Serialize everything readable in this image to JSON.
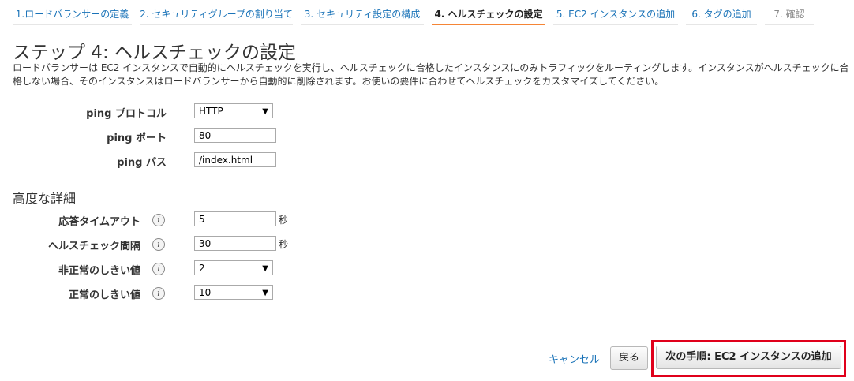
{
  "tabs": [
    {
      "label": "1.ロードバランサーの定義"
    },
    {
      "label": "2. セキュリティグループの割り当て"
    },
    {
      "label": "3. セキュリティ設定の構成"
    },
    {
      "label": "4. ヘルスチェックの設定"
    },
    {
      "label": "5. EC2 インスタンスの追加"
    },
    {
      "label": "6. タグの追加"
    },
    {
      "label": "7. 確認"
    }
  ],
  "page": {
    "title": "ステップ 4: ヘルスチェックの設定",
    "description": "ロードバランサーは EC2 インスタンスで自動的にヘルスチェックを実行し、ヘルスチェックに合格したインスタンスにのみトラフィックをルーティングします。インスタンスがヘルスチェックに合格しない場合、そのインスタンスはロードバランサーから自動的に削除されます。お使いの要件に合わせてヘルスチェックをカスタマイズしてください。"
  },
  "ping": {
    "protocol_label": "ping プロトコル",
    "protocol_value": "HTTP",
    "port_label": "ping ポート",
    "port_value": "80",
    "path_label": "ping パス",
    "path_value": "/index.html"
  },
  "advanced": {
    "title": "高度な詳細",
    "timeout_label": "応答タイムアウト",
    "timeout_value": "5",
    "timeout_unit": "秒",
    "interval_label": "ヘルスチェック間隔",
    "interval_value": "30",
    "interval_unit": "秒",
    "unhealthy_label": "非正常のしきい値",
    "unhealthy_value": "2",
    "healthy_label": "正常のしきい値",
    "healthy_value": "10"
  },
  "footer": {
    "cancel": "キャンセル",
    "back": "戻る",
    "next": "次の手順: EC2 インスタンスの追加"
  },
  "icons": {
    "info": "i",
    "caret": "▼"
  }
}
